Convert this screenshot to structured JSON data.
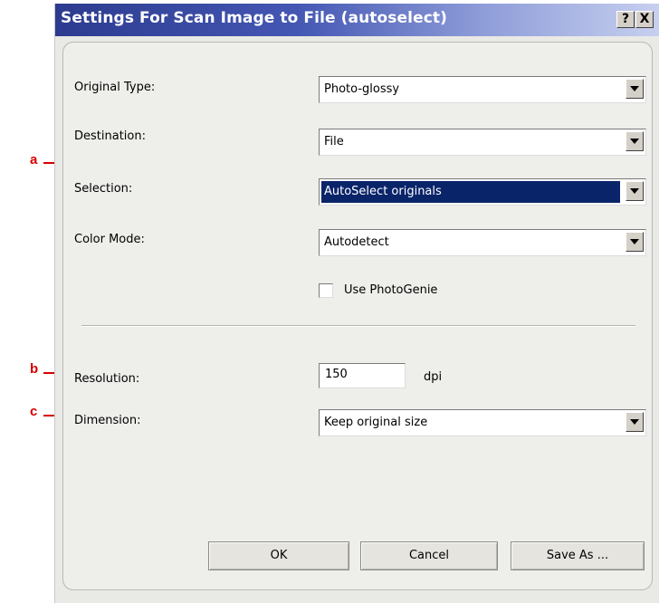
{
  "window": {
    "title": "Settings For Scan Image to File (autoselect)",
    "help_button": "?",
    "close_button": "X"
  },
  "fields": {
    "original_type": {
      "label": "Original Type:",
      "value": "Photo-glossy"
    },
    "destination": {
      "label": "Destination:",
      "value": "File"
    },
    "selection": {
      "label": "Selection:",
      "value": "AutoSelect originals"
    },
    "color_mode": {
      "label": "Color Mode:",
      "value": "Autodetect"
    },
    "use_photogenie": {
      "label": "Use PhotoGenie",
      "checked": false
    },
    "resolution": {
      "label": "Resolution:",
      "value": "150",
      "unit": "dpi"
    },
    "dimension": {
      "label": "Dimension:",
      "value": "Keep original size"
    }
  },
  "buttons": {
    "ok": "OK",
    "cancel": "Cancel",
    "save_as": "Save As ..."
  },
  "callouts": {
    "a": "a",
    "b": "b",
    "c": "c"
  },
  "colors": {
    "callout_red": "#d40000",
    "title_bar": "#2c3b8f",
    "selection_highlight": "#0a246a"
  }
}
